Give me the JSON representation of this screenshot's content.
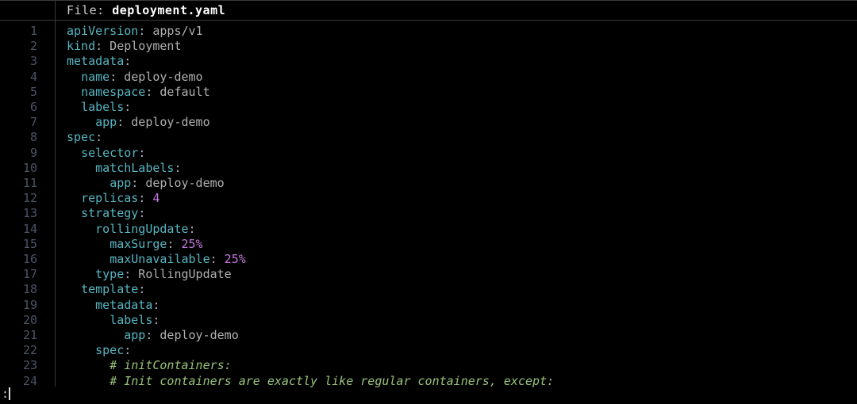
{
  "header": {
    "file_prefix": "File: ",
    "file_name": "deployment.yaml"
  },
  "colors": {
    "key": "#56b6c2",
    "value": "#c678dd",
    "string": "#b0b0b0",
    "comment": "#98c379"
  },
  "status": {
    "prompt": ":"
  },
  "code_lines": [
    {
      "n": 1,
      "tokens": [
        {
          "t": "apiVersion",
          "c": "k-key"
        },
        {
          "t": ":",
          "c": "k-punc"
        },
        {
          "t": " apps/v1",
          "c": "k-str"
        }
      ]
    },
    {
      "n": 2,
      "tokens": [
        {
          "t": "kind",
          "c": "k-key"
        },
        {
          "t": ":",
          "c": "k-punc"
        },
        {
          "t": " Deployment",
          "c": "k-str"
        }
      ]
    },
    {
      "n": 3,
      "tokens": [
        {
          "t": "metadata",
          "c": "k-key"
        },
        {
          "t": ":",
          "c": "k-punc"
        }
      ]
    },
    {
      "n": 4,
      "tokens": [
        {
          "t": "  ",
          "c": "k-punc"
        },
        {
          "t": "name",
          "c": "k-key"
        },
        {
          "t": ":",
          "c": "k-punc"
        },
        {
          "t": " deploy-demo",
          "c": "k-str"
        }
      ]
    },
    {
      "n": 5,
      "tokens": [
        {
          "t": "  ",
          "c": "k-punc"
        },
        {
          "t": "namespace",
          "c": "k-key"
        },
        {
          "t": ":",
          "c": "k-punc"
        },
        {
          "t": " default",
          "c": "k-str"
        }
      ]
    },
    {
      "n": 6,
      "tokens": [
        {
          "t": "  ",
          "c": "k-punc"
        },
        {
          "t": "labels",
          "c": "k-key"
        },
        {
          "t": ":",
          "c": "k-punc"
        }
      ]
    },
    {
      "n": 7,
      "tokens": [
        {
          "t": "    ",
          "c": "k-punc"
        },
        {
          "t": "app",
          "c": "k-key"
        },
        {
          "t": ":",
          "c": "k-punc"
        },
        {
          "t": " deploy-demo",
          "c": "k-str"
        }
      ]
    },
    {
      "n": 8,
      "tokens": [
        {
          "t": "spec",
          "c": "k-key"
        },
        {
          "t": ":",
          "c": "k-punc"
        }
      ]
    },
    {
      "n": 9,
      "tokens": [
        {
          "t": "  ",
          "c": "k-punc"
        },
        {
          "t": "selector",
          "c": "k-key"
        },
        {
          "t": ":",
          "c": "k-punc"
        }
      ]
    },
    {
      "n": 10,
      "tokens": [
        {
          "t": "    ",
          "c": "k-punc"
        },
        {
          "t": "matchLabels",
          "c": "k-key"
        },
        {
          "t": ":",
          "c": "k-punc"
        }
      ]
    },
    {
      "n": 11,
      "tokens": [
        {
          "t": "      ",
          "c": "k-punc"
        },
        {
          "t": "app",
          "c": "k-key"
        },
        {
          "t": ":",
          "c": "k-punc"
        },
        {
          "t": " deploy-demo",
          "c": "k-str"
        }
      ]
    },
    {
      "n": 12,
      "tokens": [
        {
          "t": "  ",
          "c": "k-punc"
        },
        {
          "t": "replicas",
          "c": "k-key"
        },
        {
          "t": ":",
          "c": "k-punc"
        },
        {
          "t": " 4",
          "c": "k-val"
        }
      ]
    },
    {
      "n": 13,
      "tokens": [
        {
          "t": "  ",
          "c": "k-punc"
        },
        {
          "t": "strategy",
          "c": "k-key"
        },
        {
          "t": ":",
          "c": "k-punc"
        }
      ]
    },
    {
      "n": 14,
      "tokens": [
        {
          "t": "    ",
          "c": "k-punc"
        },
        {
          "t": "rollingUpdate",
          "c": "k-key"
        },
        {
          "t": ":",
          "c": "k-punc"
        }
      ]
    },
    {
      "n": 15,
      "tokens": [
        {
          "t": "      ",
          "c": "k-punc"
        },
        {
          "t": "maxSurge",
          "c": "k-key"
        },
        {
          "t": ":",
          "c": "k-punc"
        },
        {
          "t": " 25%",
          "c": "k-val"
        }
      ]
    },
    {
      "n": 16,
      "tokens": [
        {
          "t": "      ",
          "c": "k-punc"
        },
        {
          "t": "maxUnavailable",
          "c": "k-key"
        },
        {
          "t": ":",
          "c": "k-punc"
        },
        {
          "t": " 25%",
          "c": "k-val"
        }
      ]
    },
    {
      "n": 17,
      "tokens": [
        {
          "t": "    ",
          "c": "k-punc"
        },
        {
          "t": "type",
          "c": "k-key"
        },
        {
          "t": ":",
          "c": "k-punc"
        },
        {
          "t": " RollingUpdate",
          "c": "k-str"
        }
      ]
    },
    {
      "n": 18,
      "tokens": [
        {
          "t": "  ",
          "c": "k-punc"
        },
        {
          "t": "template",
          "c": "k-key"
        },
        {
          "t": ":",
          "c": "k-punc"
        }
      ]
    },
    {
      "n": 19,
      "tokens": [
        {
          "t": "    ",
          "c": "k-punc"
        },
        {
          "t": "metadata",
          "c": "k-key"
        },
        {
          "t": ":",
          "c": "k-punc"
        }
      ]
    },
    {
      "n": 20,
      "tokens": [
        {
          "t": "      ",
          "c": "k-punc"
        },
        {
          "t": "labels",
          "c": "k-key"
        },
        {
          "t": ":",
          "c": "k-punc"
        }
      ]
    },
    {
      "n": 21,
      "tokens": [
        {
          "t": "        ",
          "c": "k-punc"
        },
        {
          "t": "app",
          "c": "k-key"
        },
        {
          "t": ":",
          "c": "k-punc"
        },
        {
          "t": " deploy-demo",
          "c": "k-str"
        }
      ]
    },
    {
      "n": 22,
      "tokens": [
        {
          "t": "    ",
          "c": "k-punc"
        },
        {
          "t": "spec",
          "c": "k-key"
        },
        {
          "t": ":",
          "c": "k-punc"
        }
      ]
    },
    {
      "n": 23,
      "tokens": [
        {
          "t": "      ",
          "c": "k-punc"
        },
        {
          "t": "# initContainers:",
          "c": "k-com"
        }
      ]
    },
    {
      "n": 24,
      "tokens": [
        {
          "t": "      ",
          "c": "k-punc"
        },
        {
          "t": "# Init containers are exactly like regular containers, except:",
          "c": "k-com"
        }
      ]
    }
  ]
}
